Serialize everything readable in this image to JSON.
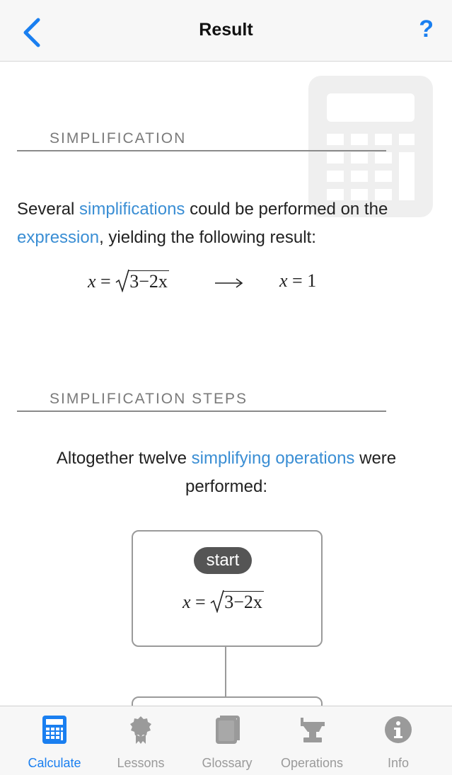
{
  "nav": {
    "title": "Result",
    "help_label": "?"
  },
  "sections": {
    "simplification": {
      "title": "SIMPLIFICATION",
      "text_before_link1": "Several ",
      "link1": "simplifications",
      "text_mid": " could be performed on the ",
      "link2": "expression",
      "text_after": ", yielding the following result:",
      "input_lhs": "x",
      "input_rhs_radicand": "3−2x",
      "result_lhs": "x",
      "result_rhs": "1"
    },
    "steps": {
      "title": "SIMPLIFICATION STEPS",
      "text_before_link": "Altogether twelve ",
      "link": "simplifying operations",
      "text_after": " were performed:",
      "start_label": "start",
      "start_lhs": "x",
      "start_radicand": "3−2x"
    }
  },
  "tabs": [
    {
      "label": "Calculate",
      "icon": "calculator-icon",
      "active": true
    },
    {
      "label": "Lessons",
      "icon": "award-ribbon-icon",
      "active": false
    },
    {
      "label": "Glossary",
      "icon": "book-icon",
      "active": false
    },
    {
      "label": "Operations",
      "icon": "anvil-icon",
      "active": false
    },
    {
      "label": "Info",
      "icon": "info-icon",
      "active": false
    }
  ],
  "colors": {
    "accent": "#1a7ff0",
    "link": "#3a8ed4",
    "inactive": "#9a9a9a"
  }
}
